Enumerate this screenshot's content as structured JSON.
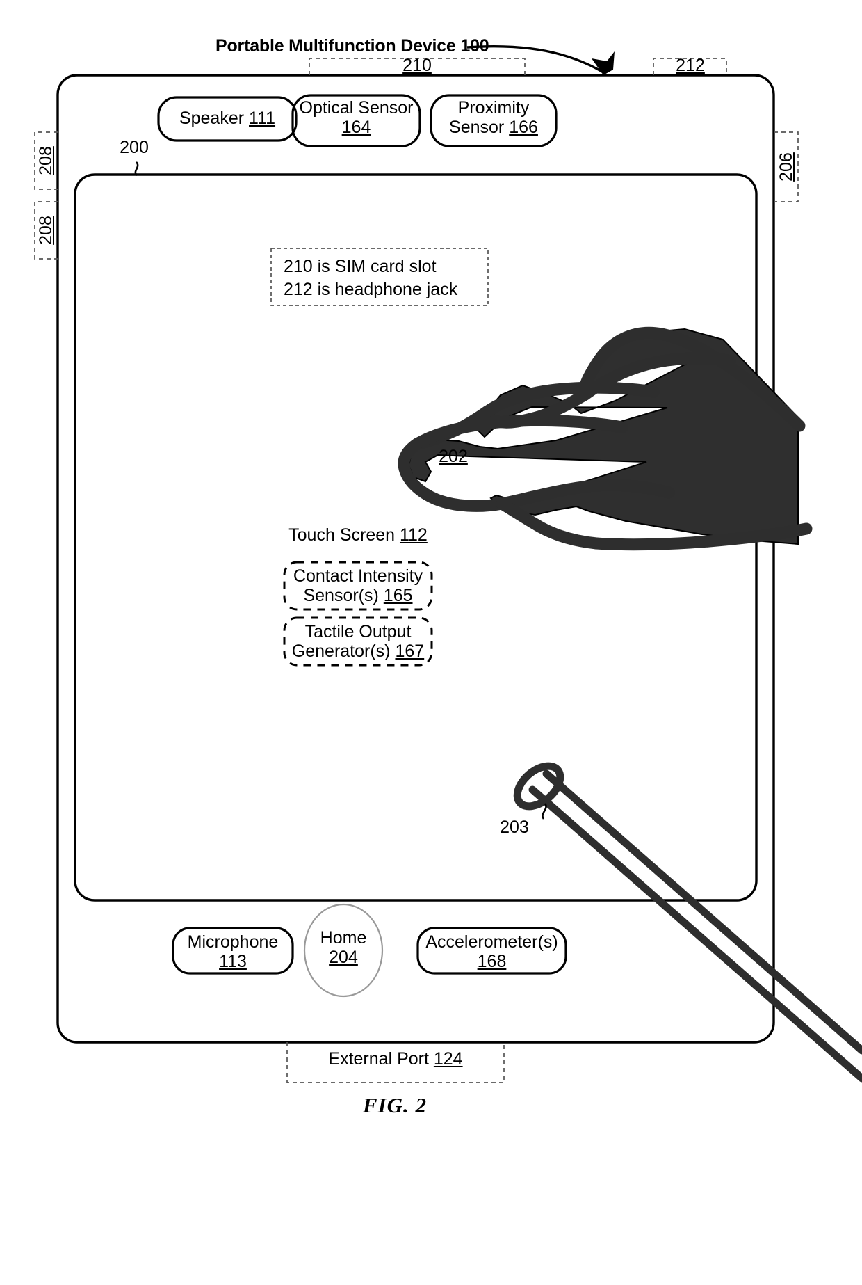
{
  "figure": {
    "title": "Portable Multifunction Device 100",
    "caption": "FIG. 2",
    "device_ref": "200",
    "touch_screen_label": "Touch Screen",
    "touch_screen_ref": "112",
    "hand_ref": "202",
    "stylus_ref": "203"
  },
  "edge_labels": {
    "sim_slot": "210",
    "headphone_jack": "212",
    "left_button_upper": "208",
    "left_button_lower": "208",
    "right_button": "206",
    "external_port_label": "External Port",
    "external_port_ref": "124"
  },
  "note": {
    "line1": "210 is SIM card slot",
    "line2": "212 is headphone jack"
  },
  "top_components": [
    {
      "label": "Speaker",
      "ref": "111",
      "two_line": false
    },
    {
      "label": "Optical Sensor",
      "ref": "164",
      "two_line": true
    },
    {
      "label": "Proximity\nSensor",
      "ref": "166",
      "two_line": true
    }
  ],
  "screen_components": [
    {
      "line1": "Contact Intensity",
      "line2": "Sensor(s)",
      "ref": "165"
    },
    {
      "line1": "Tactile Output",
      "line2": "Generator(s)",
      "ref": "167"
    }
  ],
  "bottom_components": [
    {
      "label": "Microphone",
      "ref": "113"
    },
    {
      "label": "Home",
      "ref": "204"
    },
    {
      "label": "Accelerometer(s)",
      "ref": "168"
    }
  ],
  "colors": {
    "ink": "#000000",
    "paper": "#ffffff",
    "dashed": "#555555",
    "home_outline": "#999999"
  }
}
